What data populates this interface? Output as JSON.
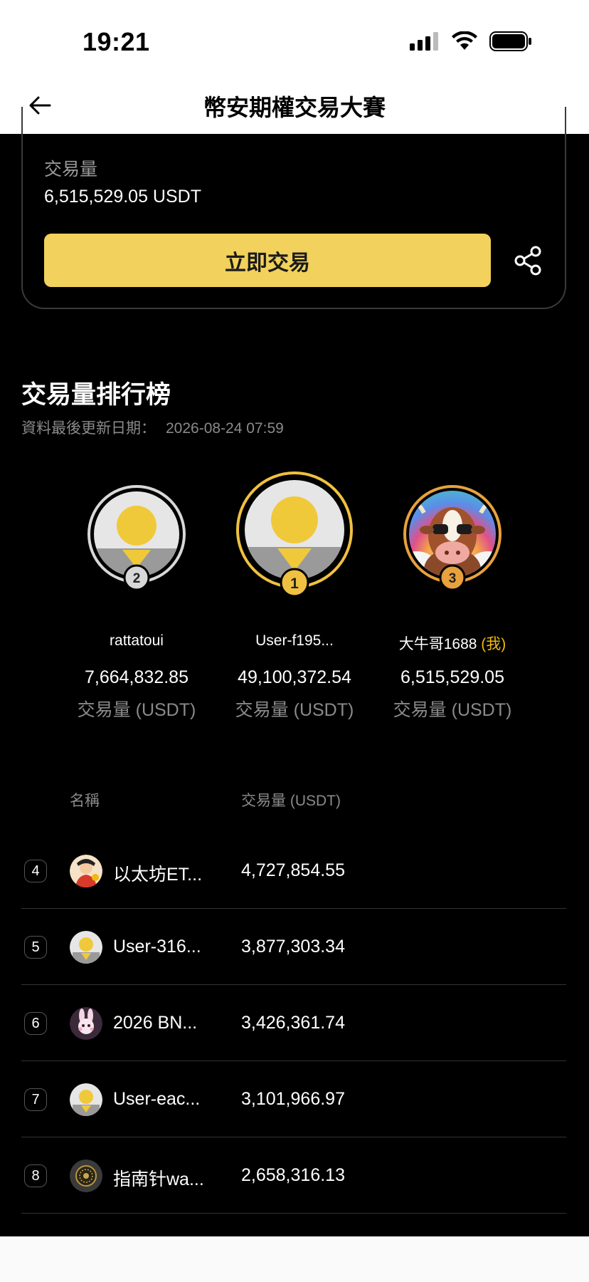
{
  "status_bar": {
    "time": "19:21"
  },
  "header": {
    "title": "幣安期權交易大賽"
  },
  "my_card": {
    "volume_label": "交易量",
    "volume_value": "6,515,529.05 USDT",
    "trade_button": "立即交易"
  },
  "leaderboard": {
    "title": "交易量排行榜",
    "update_label": "資料最後更新日期：",
    "update_time": "2026-08-24 07:59",
    "podium": [
      {
        "rank": "2",
        "name": "rattatoui",
        "value": "7,664,832.85",
        "unit": "交易量 (USDT)",
        "avatar": "default-avatar"
      },
      {
        "rank": "1",
        "name": "User-f195...",
        "value": "49,100,372.54",
        "unit": "交易量 (USDT)",
        "avatar": "default-avatar"
      },
      {
        "rank": "3",
        "name": "大牛哥1688",
        "me_tag": "(我)",
        "value": "6,515,529.05",
        "unit": "交易量 (USDT)",
        "avatar": "cow-avatar"
      }
    ],
    "columns": {
      "name": "名稱",
      "volume": "交易量 (USDT)"
    },
    "rows": [
      {
        "rank": "4",
        "name": "以太坊ET...",
        "value": "4,727,854.55",
        "avatar": "cartoon-avatar"
      },
      {
        "rank": "5",
        "name": "User-316...",
        "value": "3,877,303.34",
        "avatar": "default-avatar"
      },
      {
        "rank": "6",
        "name": "2026 BN...",
        "value": "3,426,361.74",
        "avatar": "bunny-avatar"
      },
      {
        "rank": "7",
        "name": "User-eac...",
        "value": "3,101,966.97",
        "avatar": "default-avatar"
      },
      {
        "rank": "8",
        "name": "指南针wa...",
        "value": "2,658,316.13",
        "avatar": "coin-avatar"
      }
    ]
  },
  "colors": {
    "accent": "#F2D15C",
    "brand_yellow": "#F0B90B",
    "bronze": "#E8A13C",
    "silver": "#D8D8D8"
  }
}
